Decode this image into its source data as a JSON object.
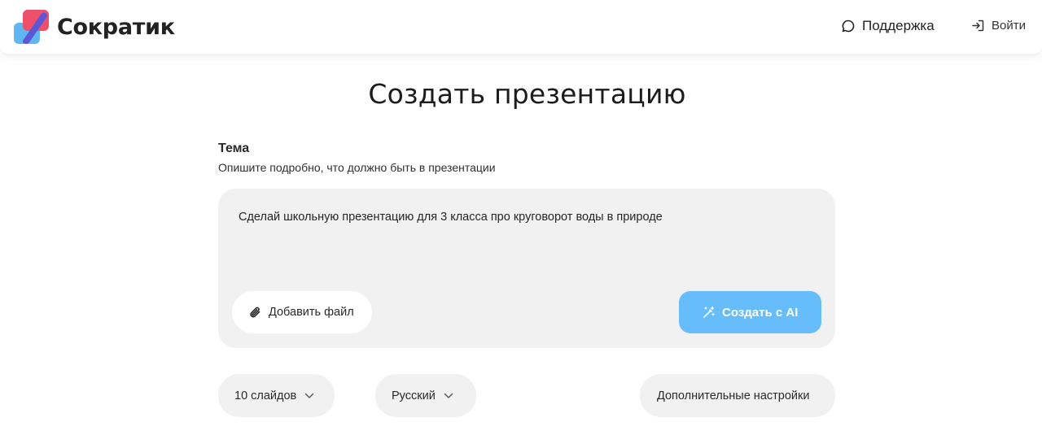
{
  "header": {
    "app_name": "Сократик",
    "support_label": "Поддержка",
    "login_label": "Войти"
  },
  "main": {
    "title": "Создать презентацию",
    "topic": {
      "label": "Тема",
      "description": "Опишите подробно, что должно быть в презентации",
      "value": "Сделай школьную презентацию для 3 класса про круговорот воды в природе"
    },
    "attach_label": "Добавить файл",
    "create_label": "Создать с AI",
    "slides_select": "10 слайдов",
    "language_select": "Русский",
    "settings_label": "Дополнительные настройки"
  },
  "icons": {
    "logo": "sokratik-logo",
    "support": "chat-bubble-icon",
    "login": "login-arrow-icon",
    "attach": "paperclip-icon",
    "create": "magic-wand-icon",
    "dropdown": "chevron-down-icon"
  },
  "colors": {
    "accent_blue": "#66bdf9",
    "logo_red": "#ee4f6a",
    "logo_purple": "#5b57d6",
    "logo_blue": "#5fb6f3",
    "card_bg": "#f1f1f1"
  }
}
